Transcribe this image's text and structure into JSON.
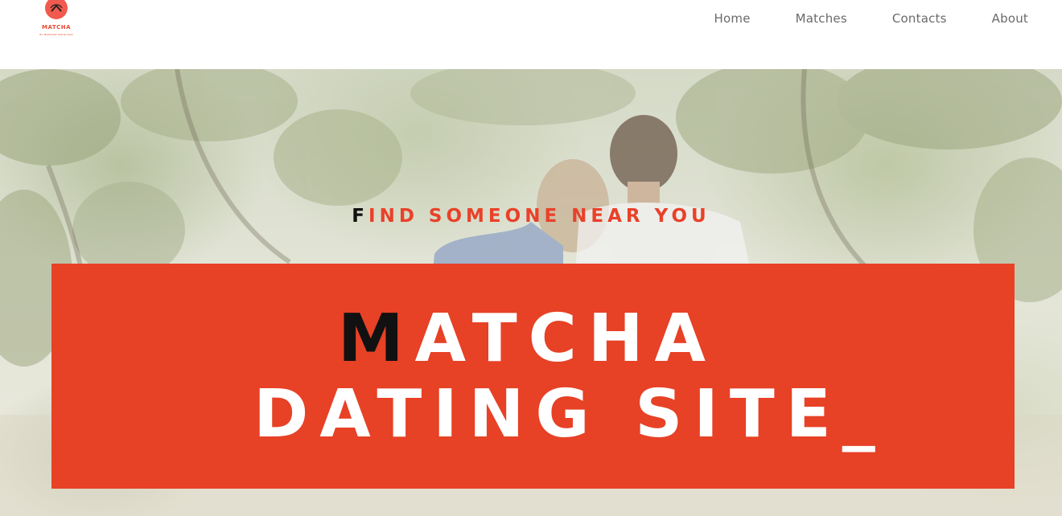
{
  "brand": {
    "name": "MATCHA",
    "tagline": "BY MARTHAR SINCE 2020",
    "accent_color": "#e74126"
  },
  "nav": {
    "items": [
      {
        "label": "Home"
      },
      {
        "label": "Matches"
      },
      {
        "label": "Contacts"
      },
      {
        "label": "About"
      }
    ]
  },
  "hero": {
    "tagline_first": "F",
    "tagline_rest": "IND SOMEONE NEAR YOU",
    "title_line1_first": "M",
    "title_line1_rest": "ATCHA",
    "title_line2": "DATING SITE_",
    "background": "couple-under-trees-photo"
  }
}
